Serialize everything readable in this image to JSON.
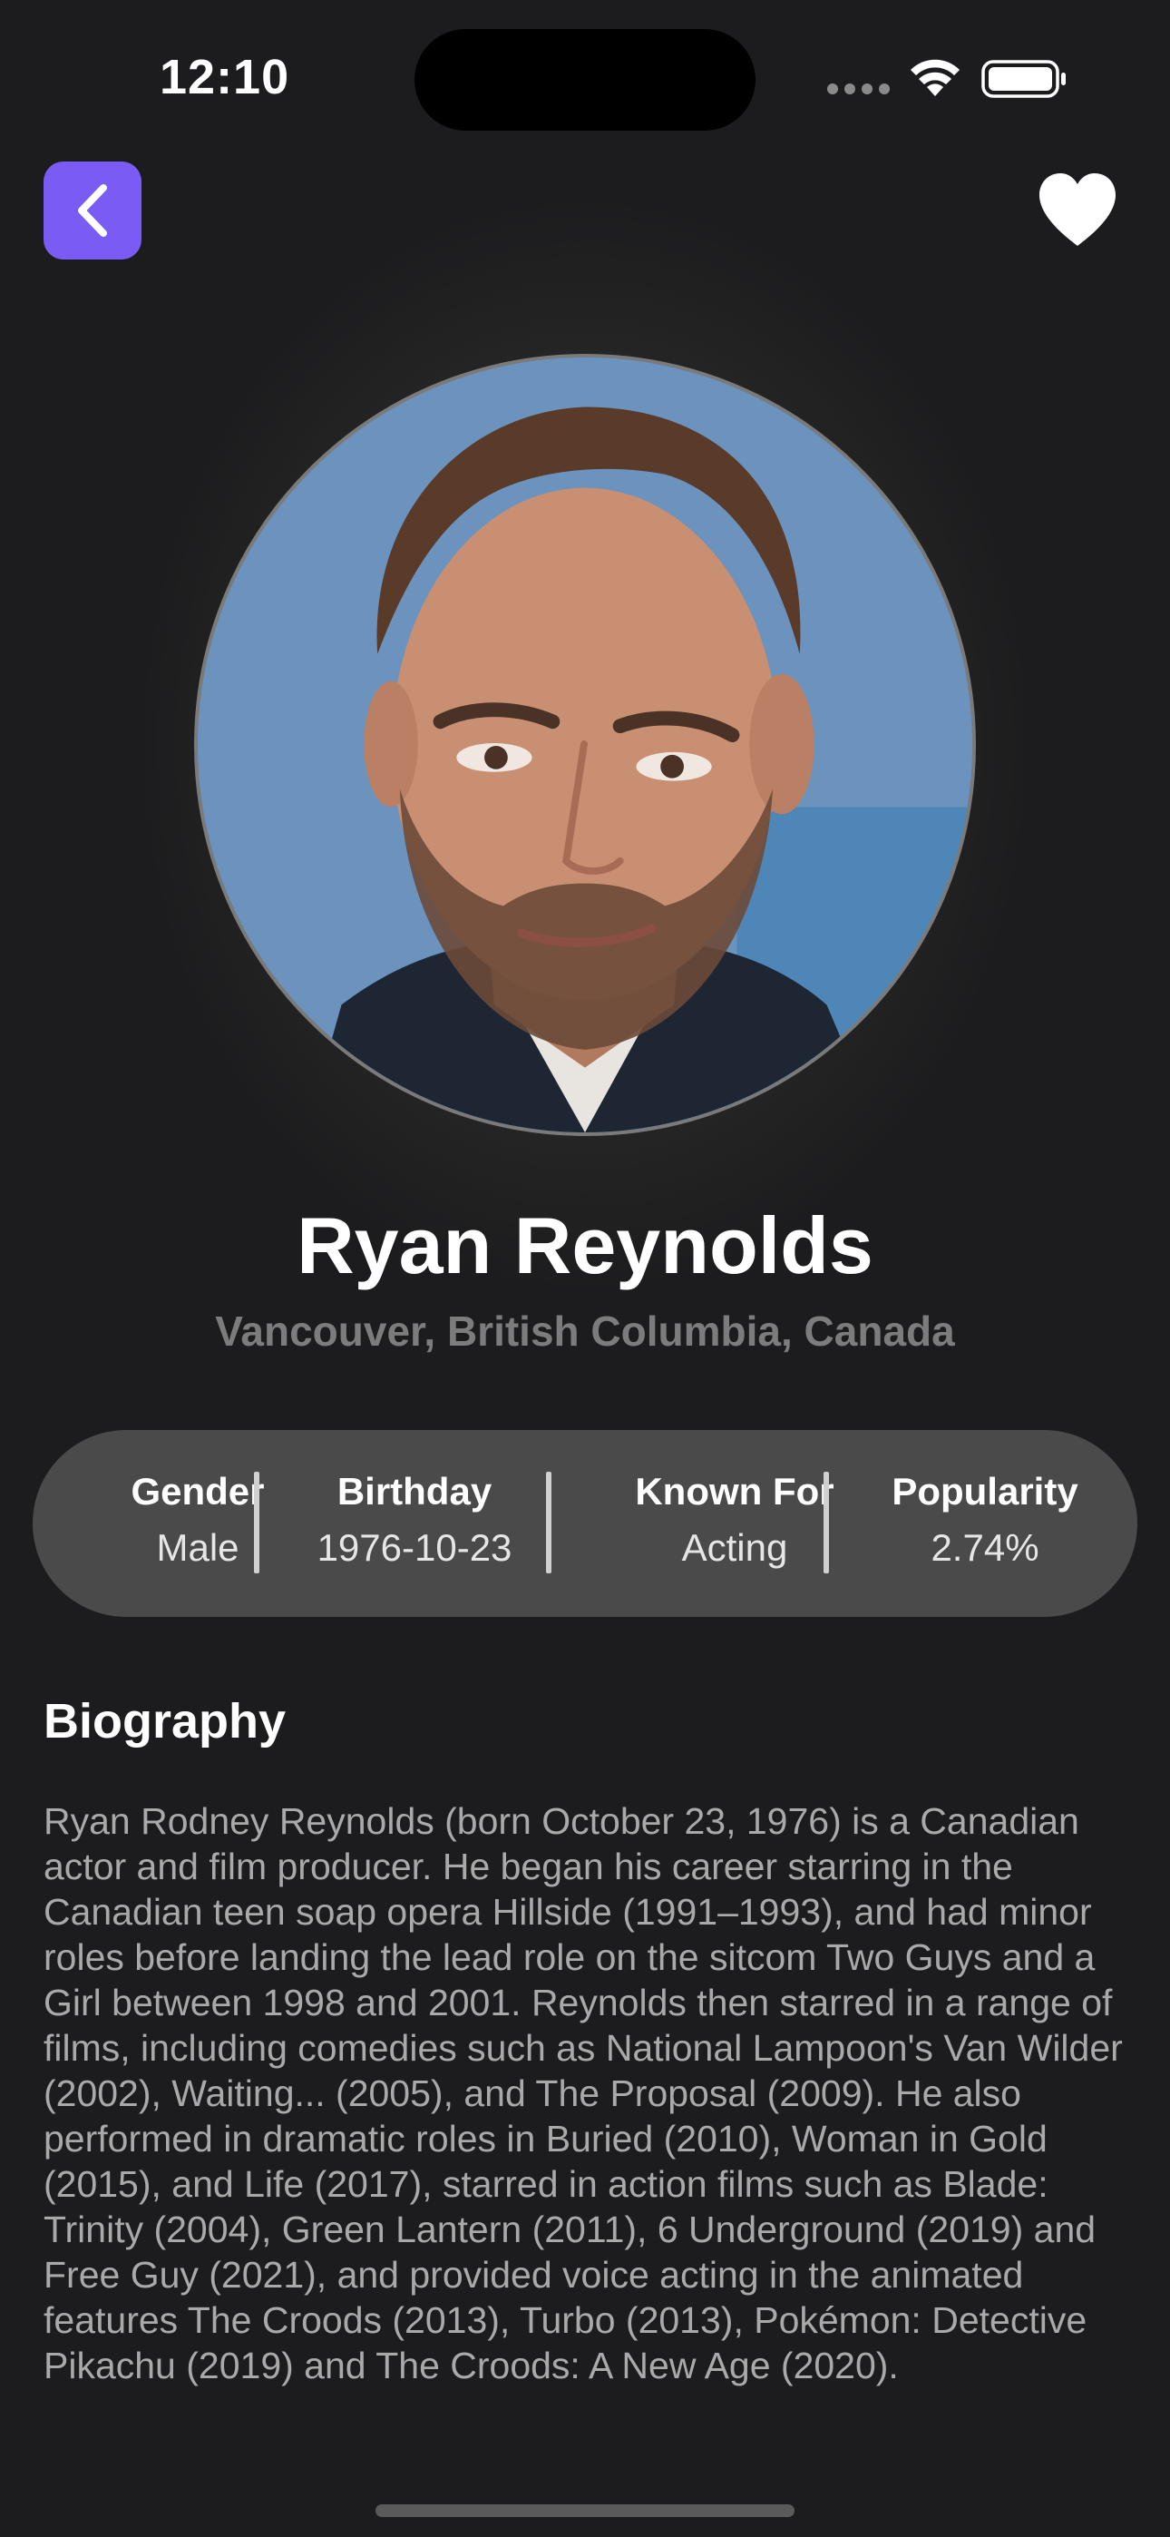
{
  "status_bar": {
    "time": "12:10"
  },
  "header": {
    "back_icon": "chevron-left-icon",
    "favorite_icon": "heart-icon"
  },
  "colors": {
    "accent": "#7a5cf5",
    "background": "#1c1c1e",
    "stats_background": "#4a4a4a",
    "secondary_text": "#7c7c7c",
    "body_text": "#a9a9a9"
  },
  "person": {
    "name": "Ryan Reynolds",
    "location": "Vancouver, British Columbia, Canada"
  },
  "stats": [
    {
      "label": "Gender",
      "value": "Male"
    },
    {
      "label": "Birthday",
      "value": "1976-10-23"
    },
    {
      "label": "Known For",
      "value": "Acting"
    },
    {
      "label": "Popularity",
      "value": "2.74%"
    }
  ],
  "biography": {
    "heading": "Biography",
    "text": "Ryan Rodney Reynolds (born October 23, 1976) is a Canadian actor and film producer. He began his career starring in the Canadian teen soap opera Hillside (1991–1993), and had minor roles before landing the lead role on the sitcom Two Guys and a Girl between 1998 and 2001. Reynolds then starred in a range of films, including comedies such as National Lampoon's Van Wilder (2002), Waiting... (2005), and The Proposal (2009). He also performed in dramatic roles in Buried (2010), Woman in Gold (2015), and Life (2017), starred in action films such as Blade: Trinity (2004), Green Lantern (2011), 6 Underground (2019) and Free Guy (2021), and provided voice acting in the animated features The Croods (2013), Turbo (2013), Pokémon: Detective Pikachu (2019) and The Croods: A New Age (2020)."
  }
}
